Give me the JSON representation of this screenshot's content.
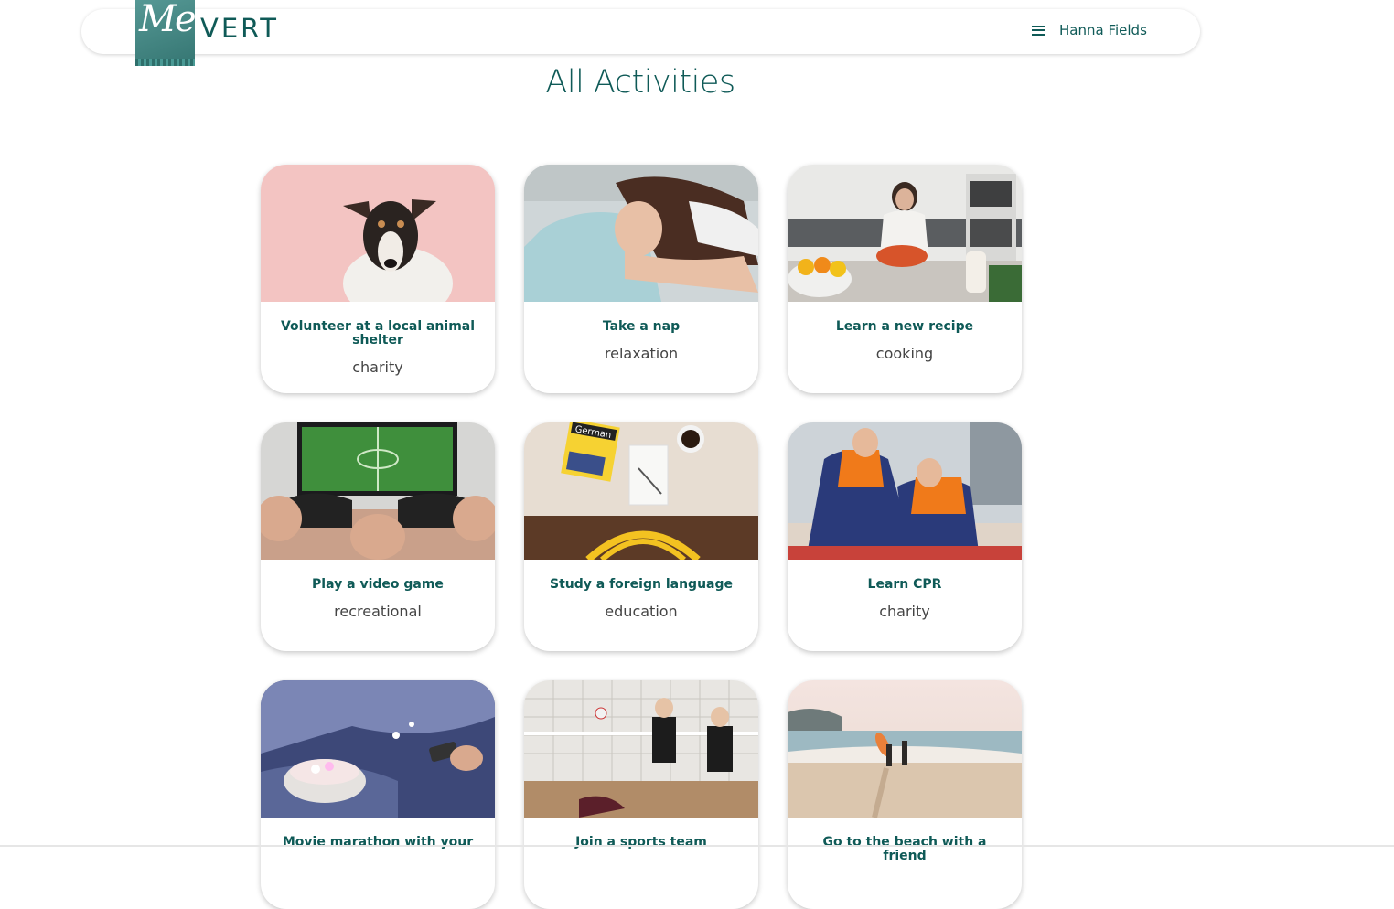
{
  "brand": {
    "script": "Me",
    "name": "VERT"
  },
  "nav": {
    "user_name": "Hanna Fields"
  },
  "page": {
    "title": "All Activities"
  },
  "activities": [
    {
      "title": "Volunteer at a local animal shelter",
      "category": "charity"
    },
    {
      "title": "Take a nap",
      "category": "relaxation"
    },
    {
      "title": "Learn a new recipe",
      "category": "cooking"
    },
    {
      "title": "Play a video game",
      "category": "recreational"
    },
    {
      "title": "Study a foreign language",
      "category": "education"
    },
    {
      "title": "Learn CPR",
      "category": "charity"
    },
    {
      "title": "Movie marathon with your",
      "category": ""
    },
    {
      "title": "Join a sports team",
      "category": ""
    },
    {
      "title": "Go to the beach with a friend",
      "category": ""
    }
  ],
  "image_text": {
    "book": "German"
  },
  "colors": {
    "brand": "#0f5a57",
    "logo_bg": "#3e8a86"
  }
}
